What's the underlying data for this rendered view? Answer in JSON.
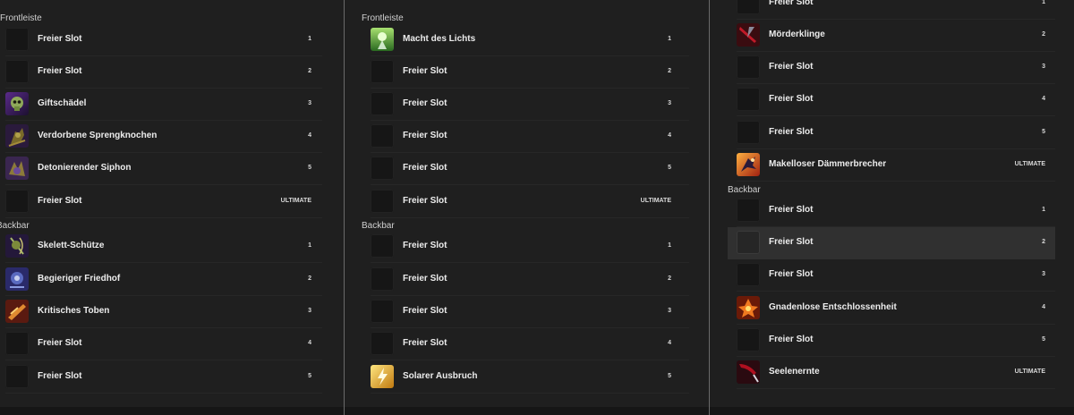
{
  "columns": [
    {
      "sections": [
        {
          "title": "Frontleiste",
          "items": [
            {
              "name": "Freier Slot",
              "slot": "1",
              "icon": "empty-slot"
            },
            {
              "name": "Freier Slot",
              "slot": "2",
              "icon": "empty-slot"
            },
            {
              "name": "Giftschädel",
              "slot": "3",
              "icon": "venom-skull-icon"
            },
            {
              "name": "Verdorbene Sprengknochen",
              "slot": "4",
              "icon": "blighted-blastbones-icon"
            },
            {
              "name": "Detonierender Siphon",
              "slot": "5",
              "icon": "detonating-siphon-icon"
            },
            {
              "name": "Freier Slot",
              "slot": "ULTIMATE",
              "icon": "empty-slot"
            }
          ]
        },
        {
          "title": "Backbar",
          "items": [
            {
              "name": "Skelett-Schütze",
              "slot": "1",
              "icon": "skeletal-archer-icon"
            },
            {
              "name": "Begieriger Friedhof",
              "slot": "2",
              "icon": "avid-boneyard-icon"
            },
            {
              "name": "Kritisches Toben",
              "slot": "3",
              "icon": "critical-rush-icon"
            },
            {
              "name": "Freier Slot",
              "slot": "4",
              "icon": "empty-slot"
            },
            {
              "name": "Freier Slot",
              "slot": "5",
              "icon": "empty-slot"
            }
          ]
        }
      ]
    },
    {
      "sections": [
        {
          "title": "Frontleiste",
          "items": [
            {
              "name": "Macht des Lichts",
              "slot": "1",
              "icon": "power-of-the-light-icon"
            },
            {
              "name": "Freier Slot",
              "slot": "2",
              "icon": "empty-slot"
            },
            {
              "name": "Freier Slot",
              "slot": "3",
              "icon": "empty-slot"
            },
            {
              "name": "Freier Slot",
              "slot": "4",
              "icon": "empty-slot"
            },
            {
              "name": "Freier Slot",
              "slot": "5",
              "icon": "empty-slot"
            },
            {
              "name": "Freier Slot",
              "slot": "ULTIMATE",
              "icon": "empty-slot"
            }
          ]
        },
        {
          "title": "Backbar",
          "items": [
            {
              "name": "Freier Slot",
              "slot": "1",
              "icon": "empty-slot"
            },
            {
              "name": "Freier Slot",
              "slot": "2",
              "icon": "empty-slot"
            },
            {
              "name": "Freier Slot",
              "slot": "3",
              "icon": "empty-slot"
            },
            {
              "name": "Freier Slot",
              "slot": "4",
              "icon": "empty-slot"
            },
            {
              "name": "Solarer Ausbruch",
              "slot": "5",
              "icon": "solar-barrage-icon"
            }
          ]
        }
      ]
    },
    {
      "sections": [
        {
          "title": "",
          "items": [
            {
              "name": "Freier Slot",
              "slot": "1",
              "icon": "empty-slot"
            },
            {
              "name": "Mörderklinge",
              "slot": "2",
              "icon": "killers-blade-icon"
            },
            {
              "name": "Freier Slot",
              "slot": "3",
              "icon": "empty-slot"
            },
            {
              "name": "Freier Slot",
              "slot": "4",
              "icon": "empty-slot"
            },
            {
              "name": "Freier Slot",
              "slot": "5",
              "icon": "empty-slot"
            },
            {
              "name": "Makelloser Dämmerbrecher",
              "slot": "ULTIMATE",
              "icon": "flawless-dawnbreaker-icon"
            }
          ]
        },
        {
          "title": "Backbar",
          "items": [
            {
              "name": "Freier Slot",
              "slot": "1",
              "icon": "empty-slot"
            },
            {
              "name": "Freier Slot",
              "slot": "2",
              "icon": "empty-slot",
              "highlighted": true
            },
            {
              "name": "Freier Slot",
              "slot": "3",
              "icon": "empty-slot"
            },
            {
              "name": "Gnadenlose Entschlossenheit",
              "slot": "4",
              "icon": "relentless-focus-icon"
            },
            {
              "name": "Freier Slot",
              "slot": "5",
              "icon": "empty-slot"
            },
            {
              "name": "Seelenernte",
              "slot": "ULTIMATE",
              "icon": "soul-harvest-icon"
            }
          ]
        }
      ]
    }
  ]
}
